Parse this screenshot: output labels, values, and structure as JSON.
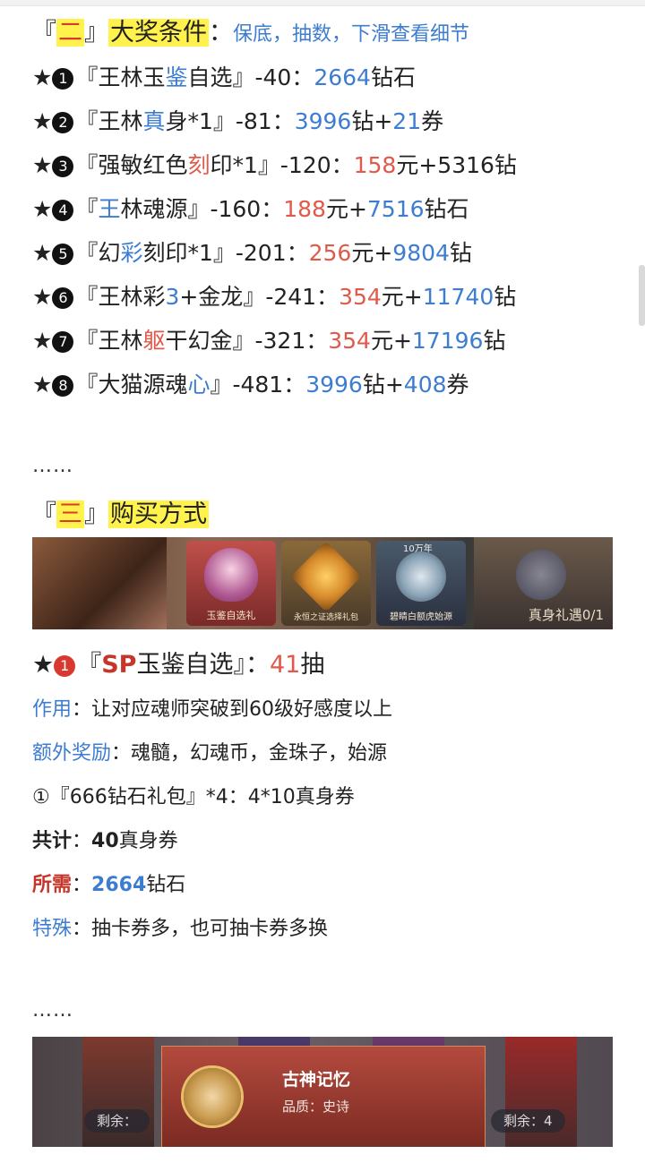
{
  "section2": {
    "bracket_open": "『",
    "num": "二",
    "bracket_close": "』",
    "title": "大奖条件",
    "colon": "：",
    "desc": "保底，抽数，下滑查看细节"
  },
  "rewards": [
    {
      "badge": "1",
      "name_pre": "王林玉",
      "name_hl": "鉴",
      "name_post": "自选",
      "suffix": "』-40：",
      "p1": "2664",
      "p1_color": "blue",
      "mid": "钻石",
      "p2": "",
      "p2_tail": ""
    },
    {
      "badge": "2",
      "name_pre": "王林",
      "name_hl": "真",
      "name_post": "身*1",
      "suffix": "』-81：",
      "p1": "3996",
      "p1_color": "blue",
      "mid": "钻+",
      "p2": "21",
      "p2_tail": "券"
    },
    {
      "badge": "3",
      "name_pre": "强敏红色",
      "name_hl": "刻",
      "name_post": "印*1",
      "suffix": "』-120：",
      "p1": "158",
      "p1_color": "red",
      "mid": "元+5316钻",
      "p2": "",
      "p2_tail": ""
    },
    {
      "badge": "4",
      "name_pre": "",
      "name_hl": "王",
      "name_post": "林魂源",
      "suffix": "』-160：",
      "p1": "188",
      "p1_color": "red",
      "mid": "元+",
      "p2": "7516",
      "p2_tail": "钻石"
    },
    {
      "badge": "5",
      "name_pre": "幻",
      "name_hl": "彩",
      "name_post": "刻印*1",
      "suffix": "』-201：",
      "p1": "256",
      "p1_color": "red",
      "mid": "元+",
      "p2": "9804",
      "p2_tail": "钻"
    },
    {
      "badge": "6",
      "name_pre": "王林彩",
      "name_hl": "3",
      "name_post": "+金龙",
      "suffix": "』-241：",
      "p1": "354",
      "p1_color": "red",
      "mid": "元+",
      "p2": "11740",
      "p2_tail": "钻"
    },
    {
      "badge": "7",
      "name_pre": "王林",
      "name_hl": "躯",
      "name_post": "干幻金",
      "suffix": "』-321：",
      "p1": "354",
      "p1_color": "red",
      "mid": "元+",
      "p2": "17196",
      "p2_tail": "钻"
    },
    {
      "badge": "8",
      "name_pre": "大猫源魂",
      "name_hl": "心",
      "name_post": "",
      "suffix": "』-481：",
      "p1": "3996",
      "p1_color": "blue",
      "mid": "钻+",
      "p2": "408",
      "p2_tail": "券"
    }
  ],
  "ellipsis": "……",
  "section3": {
    "bracket_open": "『",
    "num": "三",
    "bracket_close": "』",
    "title": "购买方式"
  },
  "banner1": {
    "card1": "玉鉴自选礼",
    "card2": "永恒之证选择礼包",
    "card3": "碧睛白额虎始源",
    "card3_top": "10万年",
    "right": "真身礼遇0/1"
  },
  "sp": {
    "star": "★",
    "badge": "1",
    "open": "『",
    "sp": "SP",
    "name": "玉鉴自选",
    "close": "』：",
    "count": "41",
    "unit": "抽"
  },
  "details": {
    "effect_label": "作用",
    "effect": "：让对应魂师突破到60级好感度以上",
    "extra_label": "额外奖励",
    "extra": "：魂髓，幻魂币，金珠子，始源",
    "pack": "①『666钻石礼包』*4：4*10真身券",
    "total_label": "共计",
    "total_sep": "：",
    "total_num": "40",
    "total_unit": "真身券",
    "need_label": "所需",
    "need_sep": "：",
    "need_num": "2664",
    "need_unit": "钻石",
    "special_label": "特殊",
    "special": "：抽卡券多，也可抽卡券多换"
  },
  "banner2": {
    "remain_left": "剩余：",
    "popup_title": "古神记忆",
    "popup_sub": "品质：史诗",
    "remain_right": "剩余：4"
  },
  "colors": {
    "blue": "#3d7dd1",
    "red": "#e05a4b",
    "highlight": "#fff24d"
  }
}
